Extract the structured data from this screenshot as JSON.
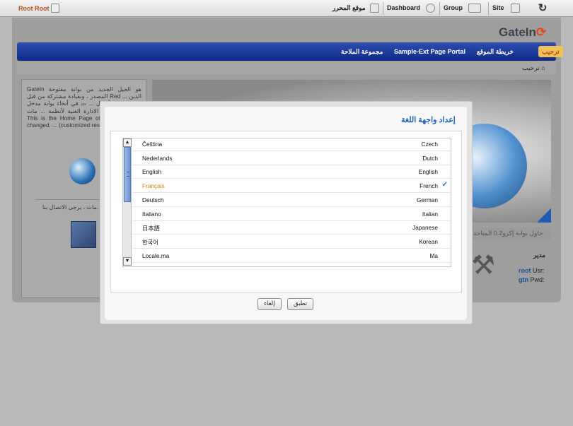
{
  "toolbar": {
    "user": "Root Root",
    "editor": "موقع المحرر",
    "dashboard": "Dashboard",
    "group": "Group",
    "site": "Site"
  },
  "brand": {
    "name_left": "GateIn",
    "name_right": ""
  },
  "nav": {
    "active": "ترحيب",
    "items": [
      "خريطة الموقع",
      "Sample-Ext Page Portal",
      "مجموعة الملاحة"
    ]
  },
  "breadcrumb": "ترحيب",
  "left_panel": {
    "paragraph": "GateIn هو الجيل الجديد من بوابة مفتوحة المصدر ، وبقيادة مشتركة من قبل Red ... الذين شريك لجمع أفضل ... ت في أنحاء بوابة مدخل فوي ... وظائف الادارة الغنية لأنظمة ... مات. This is the Home Page of th... (skin has changed, ... (customized res... :",
    "contact": "مات ، يرجى الاتصال بنا."
  },
  "portal_info": "حاول بوابة إكزو0.2 المتاحة",
  "admin": {
    "title": "مدير",
    "usr_label": "Usr:",
    "usr_value": "root",
    "pwd_label": "Pwd:",
    "pwd_value": "gtn"
  },
  "modal": {
    "title": "إعداد واجهة اللغة",
    "languages": [
      {
        "native": "Čeština",
        "english": "Czech",
        "selected": false
      },
      {
        "native": "Nederlands",
        "english": "Dutch",
        "selected": false
      },
      {
        "native": "English",
        "english": "English",
        "selected": false
      },
      {
        "native": "Français",
        "english": "French",
        "selected": true
      },
      {
        "native": "Deutsch",
        "english": "German",
        "selected": false
      },
      {
        "native": "Italiano",
        "english": "Italian",
        "selected": false
      },
      {
        "native": "日本語",
        "english": "Japanese",
        "selected": false
      },
      {
        "native": "한국어",
        "english": "Korean",
        "selected": false
      },
      {
        "native": "Locale.ma",
        "english": "Ma",
        "selected": false
      }
    ],
    "apply_button": "تطبق",
    "cancel_button": "إلغاء"
  },
  "colors": {
    "nav_blue": "#0e2a88",
    "selected_orange": "#e07a17",
    "title_blue": "#1d63b8"
  }
}
